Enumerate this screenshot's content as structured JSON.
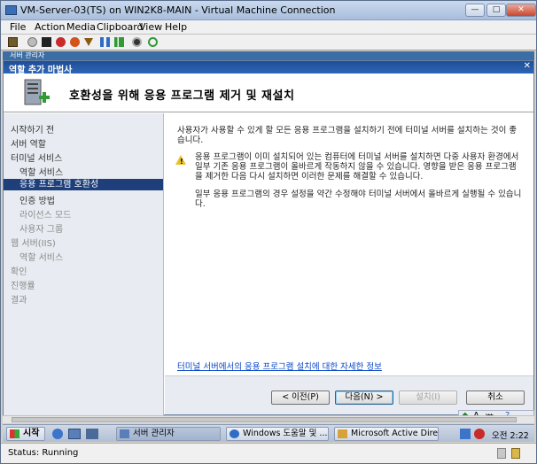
{
  "window": {
    "title": "VM-Server-03(TS) on WIN2K8-MAIN - Virtual Machine Connection",
    "min_label": "—",
    "max_label": "□",
    "close_label": "✕"
  },
  "menu": {
    "items": [
      "File",
      "Action",
      "Media",
      "Clipboard",
      "View",
      "Help"
    ]
  },
  "guest": {
    "strip_label": "서버 관리자"
  },
  "wizard": {
    "title": "역할 추가 마법사",
    "close_label": "✕",
    "heading": "호환성을 위해 응용 프로그램 제거 및 재설치",
    "nav": [
      {
        "label": "시작하기 전",
        "level": 0,
        "state": "normal"
      },
      {
        "label": "서버 역할",
        "level": 0,
        "state": "normal"
      },
      {
        "label": "터미널 서비스",
        "level": 0,
        "state": "normal"
      },
      {
        "label": "역할 서비스",
        "level": 1,
        "state": "normal"
      },
      {
        "label": "응용 프로그램 호환성",
        "level": 1,
        "state": "selected"
      },
      {
        "label": "인증 방법",
        "level": 1,
        "state": "normal"
      },
      {
        "label": "라이선스 모드",
        "level": 1,
        "state": "dim"
      },
      {
        "label": "사용자 그룹",
        "level": 1,
        "state": "dim"
      },
      {
        "label": "웹 서버(IIS)",
        "level": 0,
        "state": "dim"
      },
      {
        "label": "역할 서비스",
        "level": 1,
        "state": "dim"
      },
      {
        "label": "확인",
        "level": 0,
        "state": "dim"
      },
      {
        "label": "진행률",
        "level": 0,
        "state": "dim"
      },
      {
        "label": "결과",
        "level": 0,
        "state": "dim"
      }
    ],
    "intro_line1": "사용자가 사용할 수 있게 할 모든 응용 프로그램을 설치하기 전에 터미널 서버를 설치하는 것이 좋",
    "intro_line2": "습니다.",
    "warn_line1": "응용 프로그램이 이미 설치되어 있는 컴퓨터에 터미널 서버를 설치하면 다중 사용자 환경에서",
    "warn_line2": "일부 기존 응용 프로그램이 올바르게 작동하지 않을 수 있습니다. 영향을 받은 응용 프로그램",
    "warn_line3": "을 제거한 다음 다시 설치하면 이러한 문제를 해결할 수 있습니다.",
    "note_line1": "일부 응용 프로그램의 경우 설정을 약간 수정해야 터미널 서버에서 올바르게 실행될 수 있습니",
    "note_line2": "다.",
    "link": "터미널 서버에서의 응용 프로그램 설치에 대한 자세한 정보",
    "buttons": {
      "prev": "< 이전(P)",
      "next": "다음(N) >",
      "install": "설치(I)",
      "cancel": "취소"
    }
  },
  "taskbar": {
    "start": "시작",
    "tasks": [
      "서버 관리자",
      "Windows 도움말 및 ...",
      "Microsoft Active Dire..."
    ],
    "clock": "오전 2:22"
  },
  "langbar": {
    "label": "漢"
  },
  "status": {
    "text": "Status: Running"
  }
}
